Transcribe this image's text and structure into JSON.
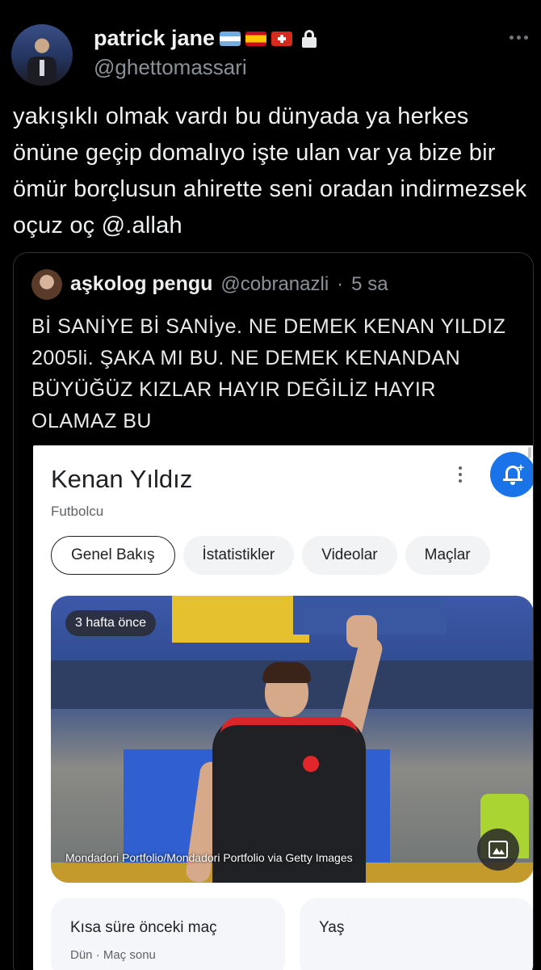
{
  "tweet": {
    "author_name": "patrick jane",
    "author_flags": [
      "flag-argentina-icon",
      "flag-spain-icon",
      "flag-switzerland-icon"
    ],
    "protected_icon": "lock-icon",
    "handle": "@ghettomassari",
    "text": "yakışıklı olmak vardı bu dünyada ya herkes önüne geçip domalıyo işte ulan var ya bize bir ömür borçlusun ahirette seni oradan indirmezsek oçuz oç @.allah"
  },
  "quoted_tweet": {
    "author_name": "aşkolog pengu",
    "handle": "@cobranazli",
    "separator": "·",
    "time": "5 sa",
    "text": "Bİ SANİYE Bİ SANİye. NE DEMEK KENAN YILDIZ 2005li. ŞAKA MI BU. NE DEMEK KENANDAN BÜYÜĞÜZ KIZLAR HAYIR DEĞİLİZ HAYIR OLAMAZ BU"
  },
  "knowledge_panel": {
    "title": "Kenan Yıldız",
    "subtitle": "Futbolcu",
    "tabs": [
      {
        "label": "Genel Bakış",
        "active": true
      },
      {
        "label": "İstatistikler",
        "active": false
      },
      {
        "label": "Videolar",
        "active": false
      },
      {
        "label": "Maçlar",
        "active": false
      }
    ],
    "photo": {
      "time_badge": "3 hafta önce",
      "credit": "Mondadori Portfolio/Mondadori Portfolio via Getty Images"
    },
    "cards": [
      {
        "title": "Kısa süre önceki maç",
        "subtitle": "Dün · Maç sonu"
      },
      {
        "title": "Yaş",
        "subtitle": ""
      }
    ],
    "accent_color": "#1a73e8"
  }
}
